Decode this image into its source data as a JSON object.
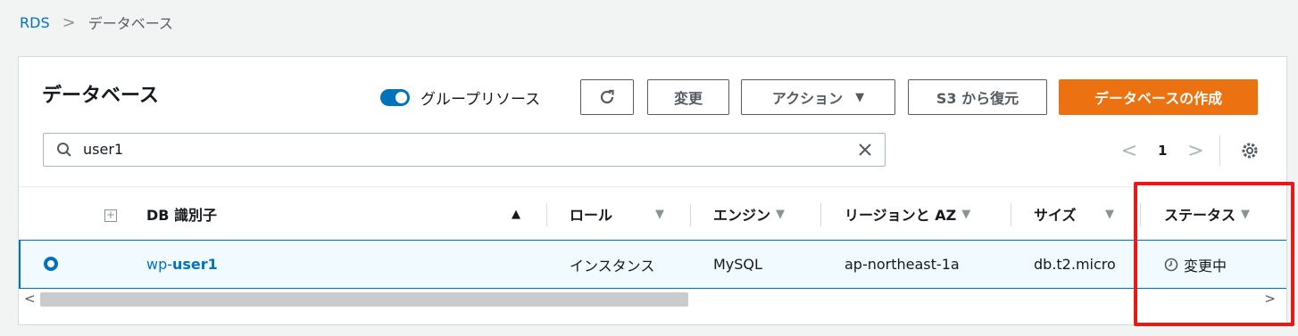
{
  "breadcrumb": {
    "root": "RDS",
    "separator": ">",
    "current": "データベース"
  },
  "panel": {
    "title": "データベース",
    "group_toggle_label": "グループリソース",
    "buttons": {
      "refresh": "C",
      "modify": "変更",
      "actions": "アクション",
      "actions_caret": "▼",
      "restore_s3": "S3 から復元",
      "create": "データベースの作成"
    },
    "search": {
      "value": "user1"
    },
    "pagination": {
      "prev": "<",
      "page": "1",
      "next": ">"
    }
  },
  "table": {
    "columns": {
      "db_id": {
        "label": "DB 識別子",
        "sort": "▲"
      },
      "role": {
        "label": "ロール",
        "sort": "▼"
      },
      "engine": {
        "label": "エンジン",
        "sort": "▼"
      },
      "region": {
        "label": "リージョンと AZ",
        "sort": "▼"
      },
      "size": {
        "label": "サイズ",
        "sort": "▼"
      },
      "status": {
        "label": "ステータス",
        "sort": "▼"
      }
    },
    "rows": [
      {
        "db_id_prefix": "wp-",
        "db_id_bold": "user1",
        "role": "インスタンス",
        "engine": "MySQL",
        "region": "ap-northeast-1a",
        "size": "db.t2.micro",
        "status": "変更中"
      }
    ]
  },
  "scrollbar": {
    "left": "<",
    "right": ">"
  },
  "colors": {
    "accent": "#0073bb",
    "primary_button": "#ec7211",
    "highlight": "#e41b17"
  }
}
